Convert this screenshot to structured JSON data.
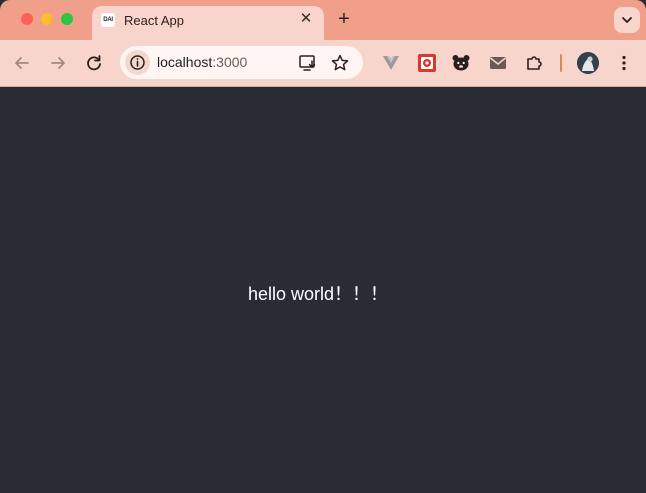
{
  "tab": {
    "title": "React App",
    "favicon_text": "DAI"
  },
  "omnibox": {
    "host": "localhost",
    "port": ":3000"
  },
  "page": {
    "text": "hello world！！！"
  },
  "icons": {
    "back": "arrow-left-icon",
    "forward": "arrow-right-icon",
    "reload": "reload-icon",
    "site_info": "info-icon",
    "install": "install-app-icon",
    "bookmark": "star-icon",
    "extensions": [
      "vue-devtools-icon",
      "red-extension-icon",
      "bear-icon",
      "mail-icon",
      "puzzle-icon"
    ],
    "menu": "kebab-menu-icon"
  },
  "colors": {
    "titlebar": "#f0a08a",
    "toolbar": "#f8d5cc",
    "page_background": "#282c34",
    "text": "#ffffff"
  }
}
